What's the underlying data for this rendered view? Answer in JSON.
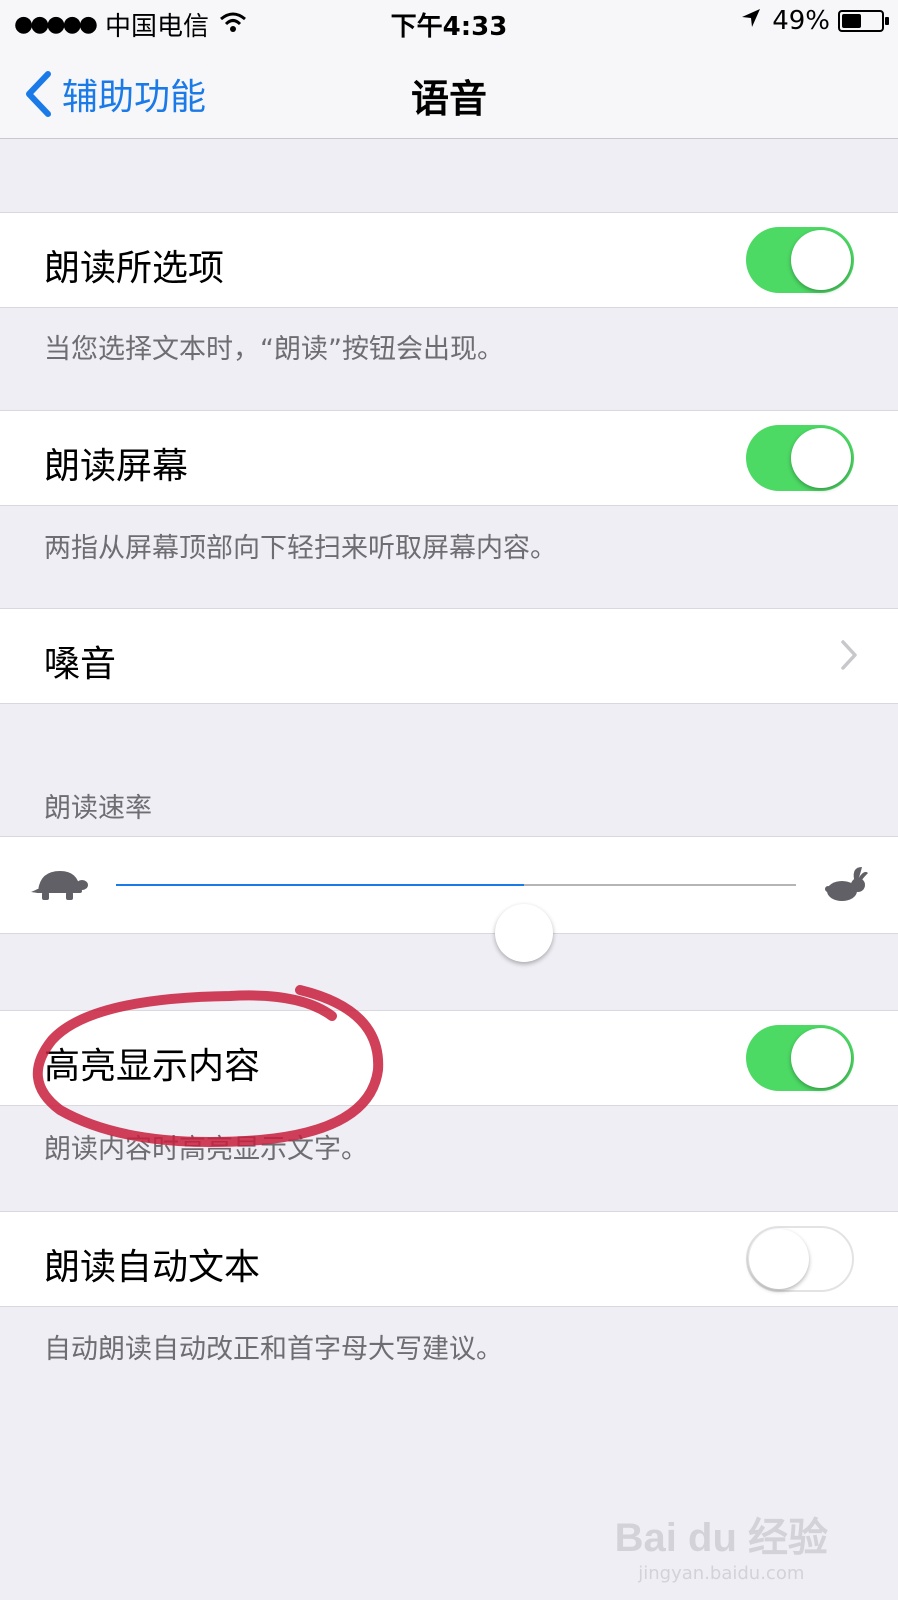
{
  "status_bar": {
    "signal": "●●●●●",
    "carrier": "中国电信",
    "time": "下午4:33",
    "battery": "49%",
    "battery_level": 0.49
  },
  "nav": {
    "back_label": "辅助功能",
    "title": "语音"
  },
  "settings": {
    "speak_selection": {
      "label": "朗读所选项",
      "enabled": true,
      "footer": "当您选择文本时，“朗读”按钮会出现。"
    },
    "speak_screen": {
      "label": "朗读屏幕",
      "enabled": true,
      "footer": "两指从屏幕顶部向下轻扫来听取屏幕内容。"
    },
    "voices": {
      "label": "嗓音"
    },
    "speaking_rate": {
      "header": "朗读速率",
      "value": 0.6
    },
    "highlight_content": {
      "label": "高亮显示内容",
      "enabled": true,
      "footer": "朗读内容时高亮显示文字。"
    },
    "speak_auto_text": {
      "label": "朗读自动文本",
      "enabled": false,
      "footer": "自动朗读自动改正和首字母大写建议。"
    }
  },
  "colors": {
    "accent": "#1a7ae8",
    "toggle_on": "#4cd964",
    "annotation": "#c81e3c"
  },
  "watermark": {
    "logo": "Bai du 经验",
    "site": "jingyan.baidu.com"
  }
}
